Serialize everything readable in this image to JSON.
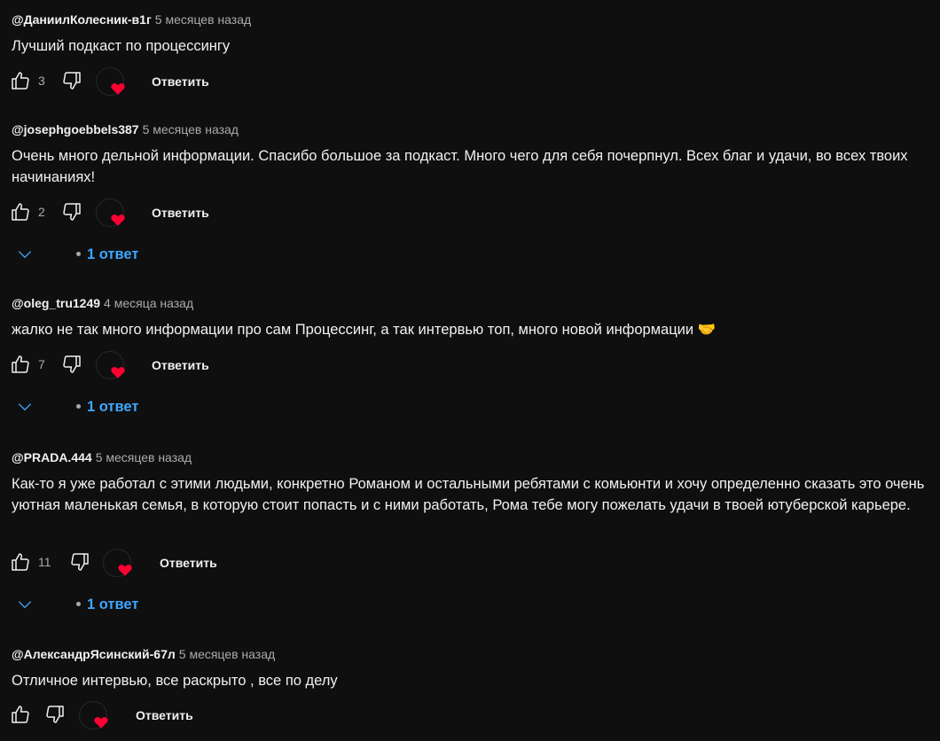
{
  "comments": [
    {
      "author": "@ДаниилКолесник-в1г",
      "time": "5 месяцев назад",
      "text": "Лучший подкаст по процессингу",
      "likes": "3",
      "reply_label": "Ответить"
    },
    {
      "author": "@josephgoebbels387",
      "time": "5 месяцев назад",
      "text": "Очень много дельной информации. Спасибо большое за подкаст. Много чего для  себя почерпнул. Всех благ и удачи, во всех твоих начинаниях!",
      "likes": "2",
      "reply_label": "Ответить",
      "replies_label": "1 ответ"
    },
    {
      "author": "@oleg_tru1249",
      "time": "4 месяца назад",
      "text": "жалко не так много информации про сам Процессинг, а так интервью топ, много новой информации 🤝",
      "likes": "7",
      "reply_label": "Ответить",
      "replies_label": "1 ответ"
    },
    {
      "author": "@PRADA.444",
      "time": "5 месяцев назад",
      "text": "Как-то я уже работал с этими людьми, конкретно Романом и остальными ребятами с комьюнти и хочу определенно сказать это очень уютная маленькая семья, в которую стоит попасть и с ними работать, Рома тебе могу пожелать удачи в твоей ютуберской карьере.",
      "likes": "11",
      "reply_label": "Ответить",
      "replies_label": "1 ответ"
    },
    {
      "author": "@АлександрЯсинский-67л",
      "time": "5 месяцев назад",
      "text": "Отличное интервью, все раскрыто , все по делу",
      "likes": "",
      "reply_label": "Ответить"
    }
  ],
  "icons": {
    "like": "thumb-up-icon",
    "dislike": "thumb-down-icon",
    "creator_heart": "heart-icon",
    "expand": "chevron-down-icon"
  },
  "colors": {
    "background": "#0f0f0f",
    "text": "#f1f1f1",
    "secondary": "#aaaaaa",
    "link": "#3ea6ff",
    "heart": "#ff0033"
  }
}
